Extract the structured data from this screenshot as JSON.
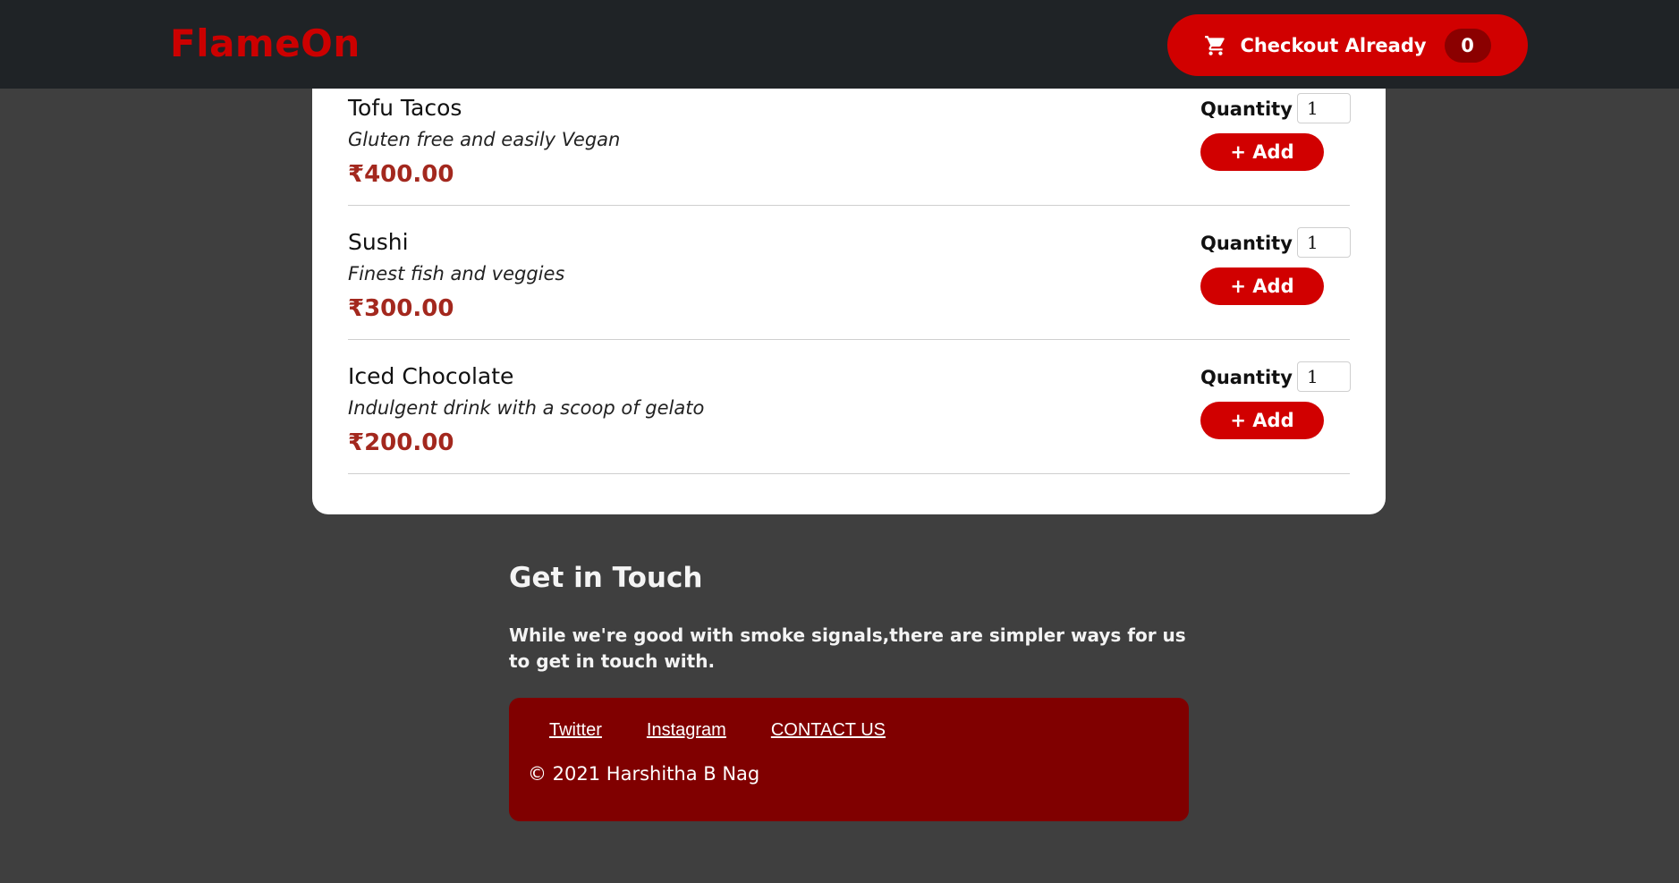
{
  "header": {
    "logo": "FlameOn",
    "cart_label": "Checkout Already",
    "cart_count": "0",
    "accent_color": "#d10000"
  },
  "menu": {
    "items": [
      {
        "name": "Tofu Tacos",
        "description": "Gluten free and easily Vegan",
        "price": "₹400.00",
        "quantity_label": "Quantity",
        "quantity": "1",
        "add_label": "+ Add"
      },
      {
        "name": "Sushi",
        "description": "Finest fish and veggies",
        "price": "₹300.00",
        "quantity_label": "Quantity",
        "quantity": "1",
        "add_label": "+ Add"
      },
      {
        "name": "Iced Chocolate",
        "description": "Indulgent drink with a scoop of gelato",
        "price": "₹200.00",
        "quantity_label": "Quantity",
        "quantity": "1",
        "add_label": "+ Add"
      }
    ]
  },
  "contact": {
    "title": "Get in Touch",
    "text": "While we're good with smoke signals,there are simpler ways for us to get in touch with."
  },
  "footer": {
    "links": [
      "Twitter",
      "Instagram",
      "CONTACT US"
    ],
    "copyright": "© 2021 Harshitha B Nag"
  }
}
